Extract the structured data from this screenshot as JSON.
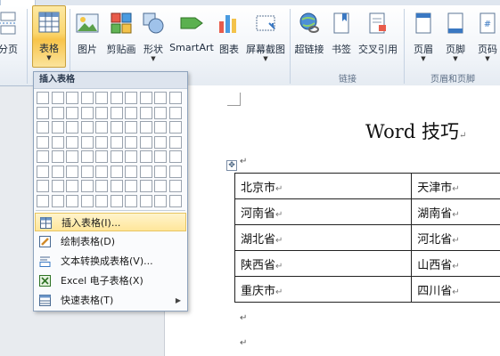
{
  "ribbon": {
    "groups": [
      {
        "label": ""
      },
      {
        "label": ""
      },
      {
        "label": "链接"
      },
      {
        "label": "页眉和页脚"
      }
    ],
    "buttons": {
      "cover": "分页",
      "table": "表格",
      "picture": "图片",
      "clipart": "剪贴画",
      "shapes": "形状",
      "smartart": "SmartArt",
      "chart": "图表",
      "screenshot": "屏幕截图",
      "hyperlink": "超链接",
      "bookmark": "书签",
      "crossref": "交叉引用",
      "header": "页眉",
      "footer": "页脚",
      "pagenum": "页码"
    }
  },
  "menu": {
    "title": "插入表格",
    "grid": {
      "cols": 10,
      "rows": 8
    },
    "items": [
      {
        "label": "插入表格(I)..."
      },
      {
        "label": "绘制表格(D)"
      },
      {
        "label": "文本转换成表格(V)..."
      },
      {
        "label": "Excel 电子表格(X)"
      },
      {
        "label": "快速表格(T)"
      }
    ]
  },
  "document": {
    "title": "Word 技巧",
    "table": [
      [
        "北京市",
        "天津市"
      ],
      [
        "河南省",
        "湖南省"
      ],
      [
        "湖北省",
        "河北省"
      ],
      [
        "陕西省",
        "山西省"
      ],
      [
        "重庆市",
        "四川省"
      ]
    ]
  },
  "colors": {
    "highlight": "#fbd66f",
    "menu_border": "#8ea3bd"
  }
}
